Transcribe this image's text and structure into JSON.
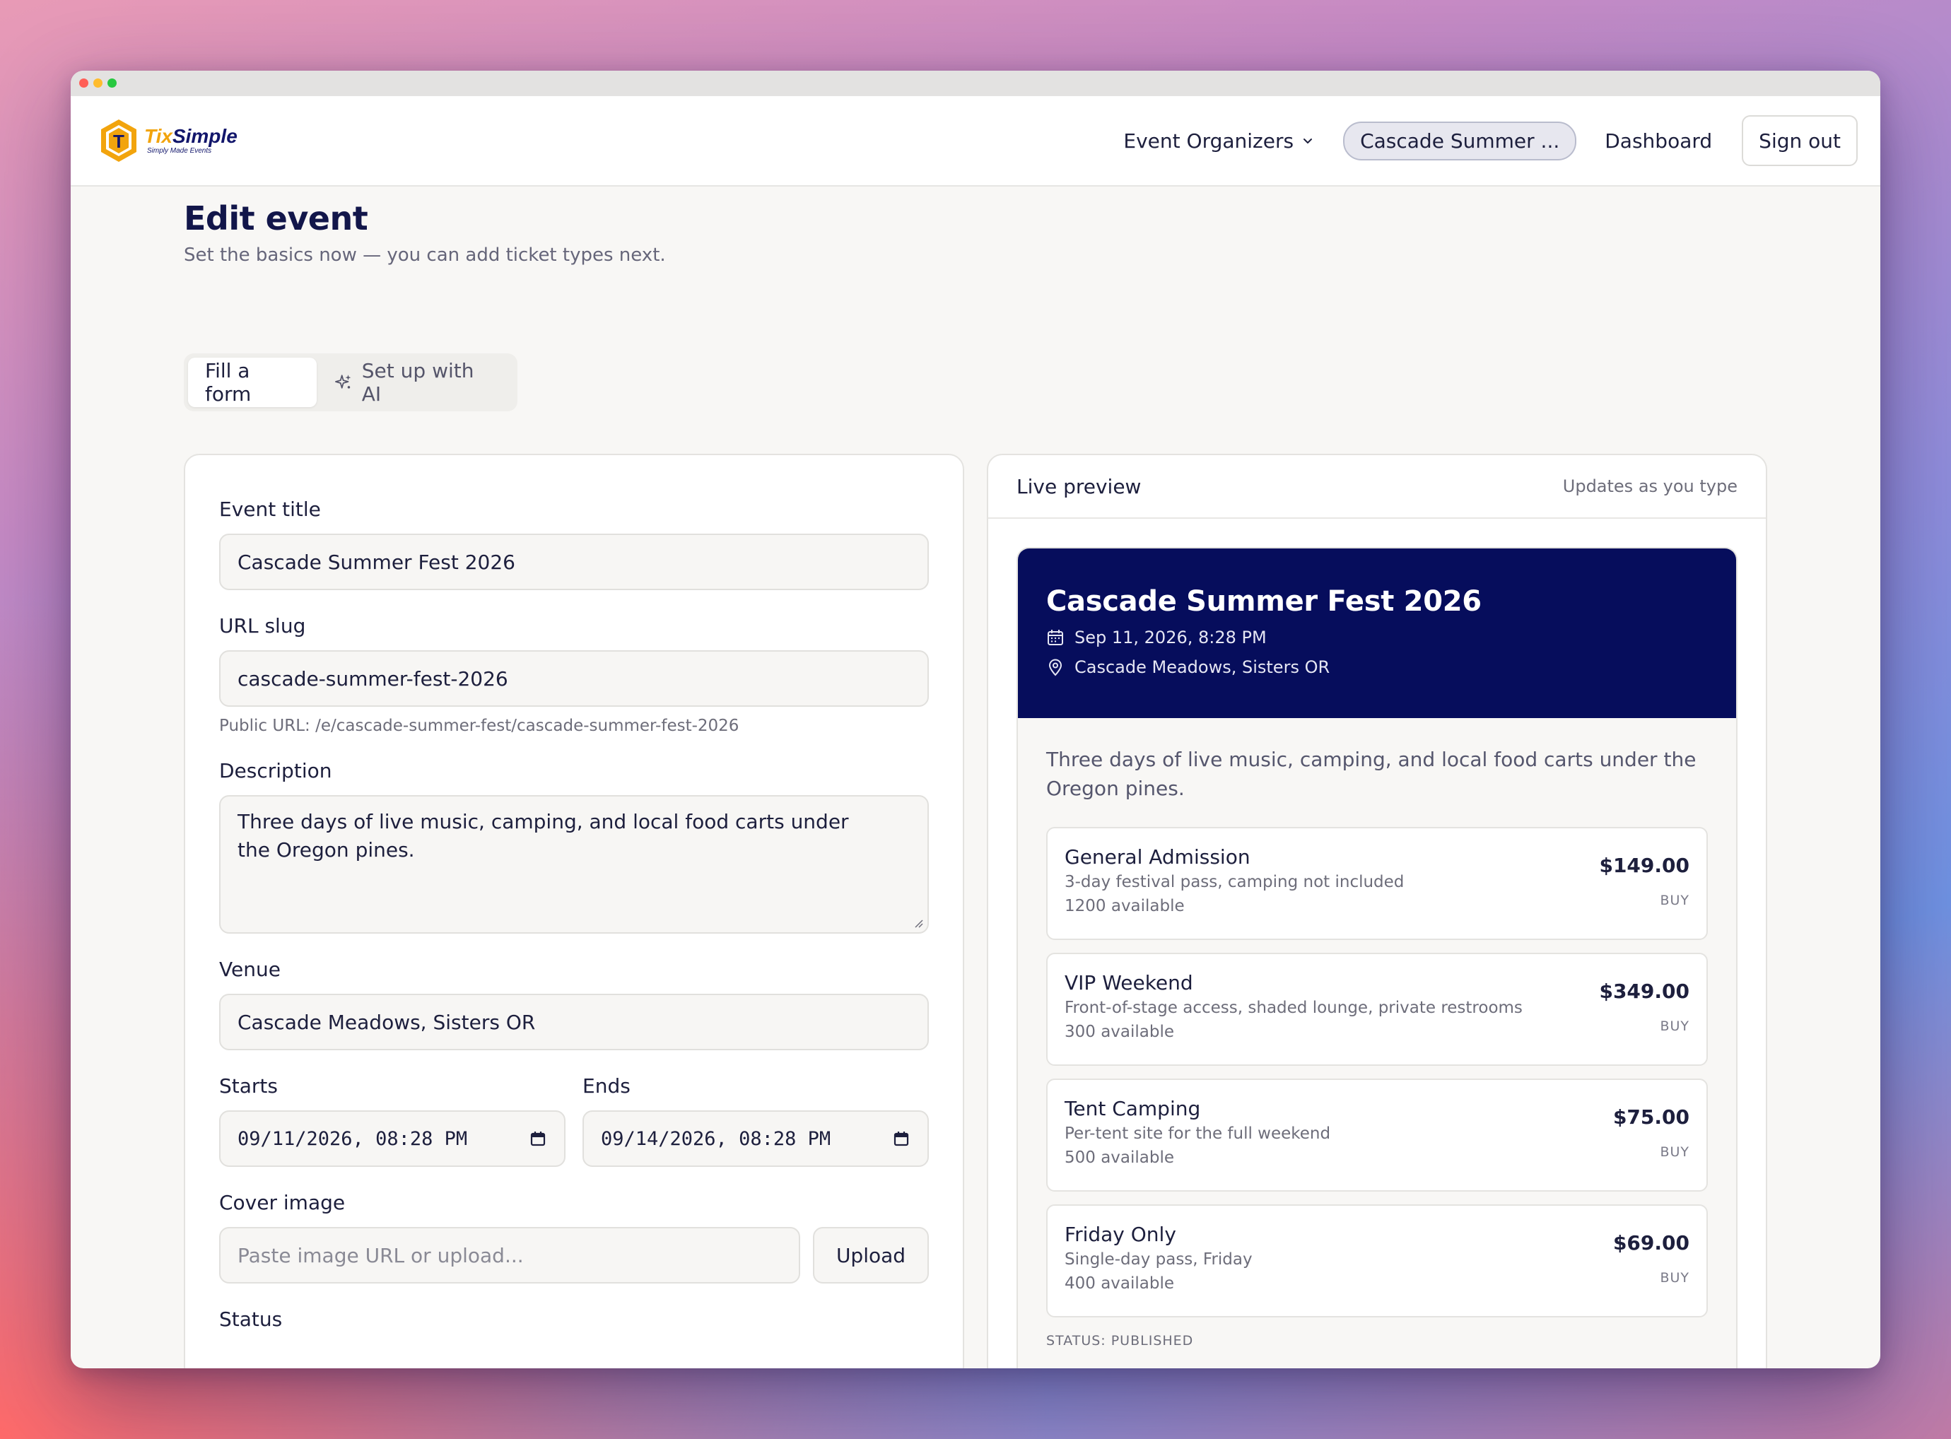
{
  "brand": {
    "name_part1": "Tix",
    "name_part2": "Simple",
    "tagline": "Simply Made Events",
    "logo_letter": "T",
    "colors": {
      "navy": "#12166b",
      "gold": "#f2a40d"
    }
  },
  "nav": {
    "organizers_label": "Event Organizers",
    "event_pill": "Cascade Summer ...",
    "dashboard_label": "Dashboard",
    "sign_out_label": "Sign out"
  },
  "page": {
    "title": "Edit event",
    "subtitle": "Set the basics now — you can add ticket types next."
  },
  "mode_tabs": {
    "form_label": "Fill a form",
    "ai_label": "Set up with AI",
    "active": "form"
  },
  "form": {
    "title_label": "Event title",
    "title_value": "Cascade Summer Fest 2026",
    "slug_label": "URL slug",
    "slug_value": "cascade-summer-fest-2026",
    "public_url_help": "Public URL: /e/cascade-summer-fest/cascade-summer-fest-2026",
    "description_label": "Description",
    "description_value": "Three days of live music, camping, and local food carts under the Oregon pines.",
    "venue_label": "Venue",
    "venue_value": "Cascade Meadows, Sisters OR",
    "starts_label": "Starts",
    "starts_value": "09/11/2026, 08:28 PM",
    "ends_label": "Ends",
    "ends_value": "09/14/2026, 08:28 PM",
    "cover_label": "Cover image",
    "cover_placeholder": "Paste image URL or upload...",
    "upload_label": "Upload",
    "status_label": "Status"
  },
  "preview": {
    "header_label": "Live preview",
    "header_hint": "Updates as you type",
    "event_title": "Cascade Summer Fest 2026",
    "date": "Sep 11, 2026, 8:28 PM",
    "location": "Cascade Meadows, Sisters OR",
    "description": "Three days of live music, camping, and local food carts under the Oregon pines.",
    "banner_color": "#060d5c",
    "tickets": [
      {
        "name": "General Admission",
        "desc": "3-day festival pass, camping not included",
        "avail": "1200 available",
        "price": "$149.00",
        "buy": "BUY"
      },
      {
        "name": "VIP Weekend",
        "desc": "Front-of-stage access, shaded lounge, private restrooms",
        "avail": "300 available",
        "price": "$349.00",
        "buy": "BUY"
      },
      {
        "name": "Tent Camping",
        "desc": "Per-tent site for the full weekend",
        "avail": "500 available",
        "price": "$75.00",
        "buy": "BUY"
      },
      {
        "name": "Friday Only",
        "desc": "Single-day pass, Friday",
        "avail": "400 available",
        "price": "$69.00",
        "buy": "BUY"
      }
    ],
    "status": "STATUS: PUBLISHED"
  },
  "icons": {
    "chevron": "chevron-down-icon",
    "sparkle": "sparkle-icon",
    "calendar": "calendar-icon",
    "pin": "map-pin-icon"
  }
}
